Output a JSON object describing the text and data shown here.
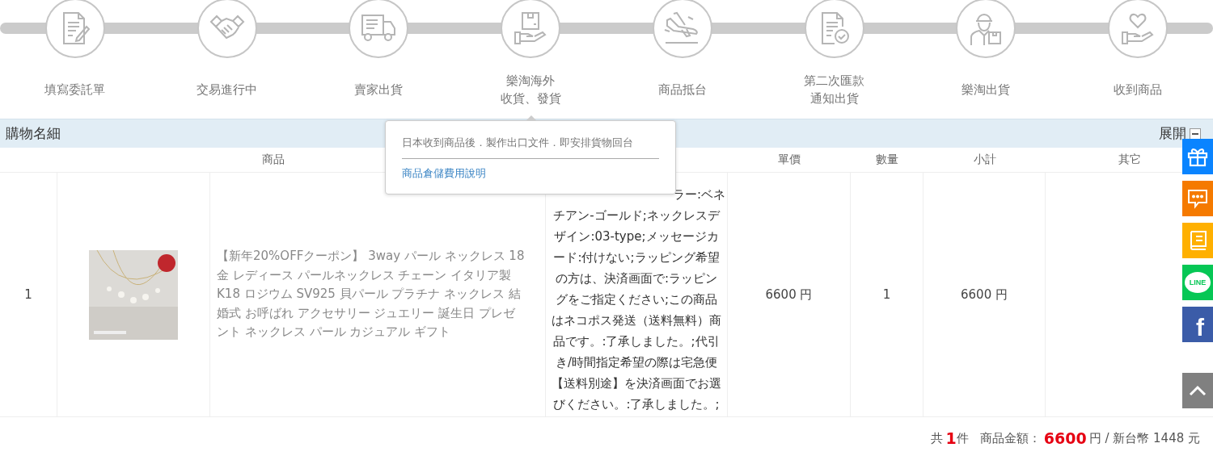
{
  "steps": [
    {
      "lines": [
        "填寫委託單"
      ]
    },
    {
      "lines": [
        "交易進行中"
      ]
    },
    {
      "lines": [
        "賣家出貨"
      ]
    },
    {
      "lines": [
        "樂淘海外",
        "收貨、發貨"
      ]
    },
    {
      "lines": [
        "商品抵台"
      ]
    },
    {
      "lines": [
        "第二次匯款",
        "通知出貨"
      ]
    },
    {
      "lines": [
        "樂淘出貨"
      ]
    },
    {
      "lines": [
        "收到商品"
      ]
    }
  ],
  "tooltip": {
    "text": "日本收到商品後．製作出口文件．即安排貨物回台",
    "link": "商品倉儲費用說明"
  },
  "section": {
    "title": "購物名細",
    "toggle": "展開",
    "expanded": true
  },
  "table": {
    "columns": [
      "商品",
      "單價",
      "數量",
      "小計",
      "其它"
    ],
    "rows": [
      {
        "index": "1",
        "name": "【新年20%OFFクーポン】 3way パール ネックレス 18金 レディース パールネックレス チェーン イタリア製 K18 ロジウム SV925 貝パール プラチナ ネックレス 結婚式 お呼ばれ アクセサリー ジュエリー 誕生日 プレゼント ネックレス パール カジュアル ギフト",
        "spec": [
          "ラー:ベネ",
          "チアン-ゴールド;ネックレスデ",
          "ザイン:03-type;メッセージカ",
          "ード:付けない;ラッピング希望",
          "の方は、決済画面で:ラッピン",
          "グをご指定ください;この商品",
          "はネコポス発送（送料無料）商",
          "品です。:了承しました。;代引",
          "き/時間指定希望の際は宅急便",
          "【送料別途】を決済画面でお選",
          "びください。:了承しました。;"
        ],
        "unit_price": "6600 円",
        "quantity": "1",
        "subtotal": "6600 円"
      }
    ]
  },
  "summary": {
    "prefix": "共",
    "count": "1",
    "count_unit": "件",
    "amount_label": "商品金額：",
    "amount": "6600",
    "rest": "円 / 新台幣 1448 元"
  },
  "side_buttons": [
    {
      "kind": "gift",
      "color": "#0a84ff"
    },
    {
      "kind": "chat",
      "color": "#f57a00"
    },
    {
      "kind": "book",
      "color": "#ffb000"
    },
    {
      "kind": "line",
      "color": "#06c755",
      "text": "LINE"
    },
    {
      "kind": "facebook",
      "color": "#3b5ca8",
      "text": "f"
    },
    {
      "kind": "top",
      "color": "#808080"
    }
  ]
}
